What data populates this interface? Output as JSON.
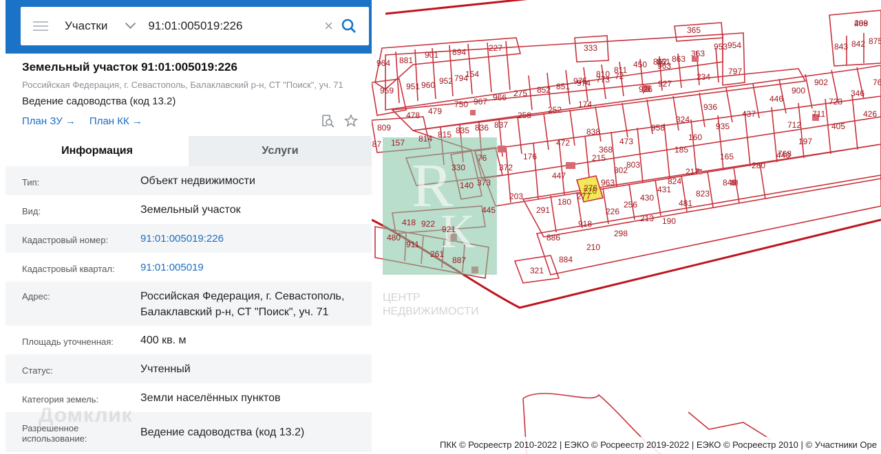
{
  "search": {
    "menu_icon": "hamburger-icon",
    "type_label": "Участки",
    "query": "91:01:005019:226",
    "clear_icon": "close-icon",
    "search_icon": "search-icon"
  },
  "parcel": {
    "title": "Земельный участок 91:01:005019:226",
    "address": "Российская Федерация, г. Севастополь, Балаклавский р-н, СТ \"Поиск\", уч. 71",
    "use": "Ведение садоводства (код 13.2)",
    "link_plan_zu": "План ЗУ →",
    "link_plan_kk": "План КК →"
  },
  "tabs": {
    "info": "Информация",
    "services": "Услуги"
  },
  "details": [
    {
      "label": "Тип:",
      "value": "Объект недвижимости"
    },
    {
      "label": "Вид:",
      "value": "Земельный участок"
    },
    {
      "label": "Кадастровый номер:",
      "value": "91:01:005019:226"
    },
    {
      "label": "Кадастровый квартал:",
      "value": "91:01:005019"
    },
    {
      "label": "Адрес:",
      "value": "Российская Федерация, г. Севастополь, Балаклавский р-н, СТ \"Поиск\", уч. 71"
    },
    {
      "label": "Площадь уточненная:",
      "value": "400 кв. м"
    },
    {
      "label": "Статус:",
      "value": "Учтенный"
    },
    {
      "label": "Категория земель:",
      "value": "Земли населённых пунктов"
    },
    {
      "label": "Разрешенное использование:",
      "value": "Ведение садоводства (код 13.2)"
    }
  ],
  "map": {
    "highlight_label": "226",
    "attribution": "ПКК © Росреестр 2010-2022 | ЕЭКО © Росреестр 2019-2022 | ЕЭКО © Росреестр 2010 | © Участники Ope",
    "watermark_logo": "ЦЕНТР НЕДВИЖИМОСТИ",
    "parcel_labels": [
      "408",
      "843",
      "842",
      "875",
      "365",
      "333",
      "894",
      "227",
      "901",
      "881",
      "964",
      "154",
      "963",
      "861",
      "951",
      "959",
      "960",
      "952",
      "794",
      "975",
      "810",
      "811",
      "450",
      "862",
      "863",
      "363",
      "953",
      "954",
      "797",
      "902",
      "346",
      "760",
      "275",
      "852",
      "851",
      "974",
      "773",
      "72",
      "926",
      "927",
      "234",
      "446",
      "900",
      "723",
      "426",
      "478",
      "479",
      "750",
      "967",
      "966",
      "258",
      "252",
      "174",
      "936",
      "437",
      "711",
      "405",
      "809",
      "814",
      "815",
      "835",
      "836",
      "837",
      "838",
      "958",
      "324",
      "935",
      "197",
      "712",
      "157",
      "787",
      "76",
      "472",
      "473",
      "160",
      "165",
      "440",
      "330",
      "176",
      "368",
      "803",
      "185",
      "768",
      "280",
      "140",
      "373",
      "372",
      "447",
      "215",
      "802",
      "217",
      "849",
      "203",
      "963",
      "445",
      "291",
      "180",
      "277",
      "276",
      "226",
      "256",
      "430",
      "431",
      "824",
      "823",
      "418",
      "922",
      "921",
      "918",
      "213",
      "190",
      "481",
      "480",
      "911",
      "886",
      "210",
      "298",
      "261",
      "887",
      "884",
      "321",
      "289"
    ],
    "footer_watermark": "Домклик"
  }
}
